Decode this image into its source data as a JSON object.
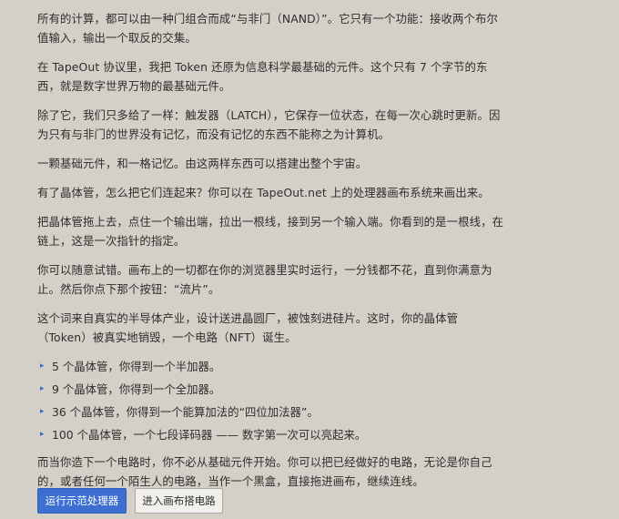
{
  "article": {
    "paragraphs": [
      "所有的计算，都可以由一种门组合而成“与非门（NAND）”。它只有一个功能：接收两个布尔值输入，输出一个取反的交集。",
      "在 TapeOut 协议里，我把 Token 还原为信息科学最基础的元件。这个只有 7 个字节的东西，就是数字世界万物的最基础元件。",
      "除了它，我们只多给了一样：触发器（LATCH），它保存一位状态，在每一次心跳时更新。因为只有与非门的世界没有记忆，而没有记忆的东西不能称之为计算机。",
      "一颗基础元件，和一格记忆。由这两样东西可以搭建出整个宇宙。",
      "有了晶体管，怎么把它们连起来？你可以在 TapeOut.net 上的处理器画布系统来画出来。",
      "把晶体管拖上去，点住一个输出端，拉出一根线，接到另一个输入端。你看到的是一根线，在链上，这是一次指针的指定。",
      "你可以随意试错。画布上的一切都在你的浏览器里实时运行，一分钱都不花，直到你满意为止。然后你点下那个按钮：“流片”。",
      "这个词来自真实的半导体产业，设计送进晶圆厂，被蚀刻进硅片。这时，你的晶体管（Token）被真实地销毁，一个电路（NFT）诞生。"
    ],
    "list": [
      "5 个晶体管，你得到一个半加器。",
      "9 个晶体管，你得到一个全加器。",
      "36 个晶体管，你得到一个能算加法的“四位加法器”。",
      "100 个晶体管，一个七段译码器 —— 数字第一次可以亮起来。"
    ],
    "closing": "而当你造下一个电路时，你不必从基础元件开始。你可以把已经做好的电路，无论是你自己的，或者任何一个陌生人的电路，当作一个黑盒，直接拖进画布，继续连线。"
  },
  "bullet_glyph": "▸",
  "actions": {
    "primary_label": "运行示范处理器",
    "secondary_label": "进入画布搭电路"
  },
  "colors": {
    "background": "#d4d0c8",
    "text": "#2e2e2e",
    "accent": "#3d6fd3",
    "bullet": "#3a6cc4"
  }
}
